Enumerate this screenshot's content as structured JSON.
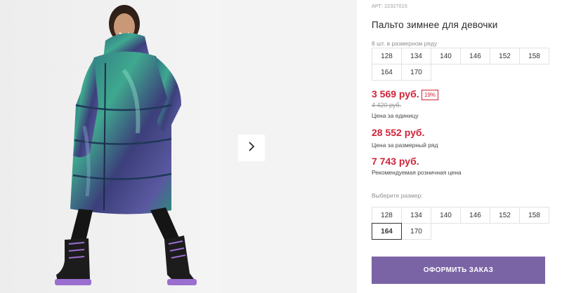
{
  "gallery": {
    "photo_alt": "Пальто зимнее для девочки",
    "next_icon": "chevron-right-icon"
  },
  "product": {
    "sku": "АРТ: 22327015",
    "title": "Пальто зимнее для девочки",
    "series_label": "8 шт. в размерном ряду",
    "series_sizes": [
      "128",
      "134",
      "140",
      "146",
      "152",
      "158",
      "164",
      "170"
    ],
    "price_unit": "3 569 руб.",
    "discount": "19%",
    "price_old": "4 420 руб.",
    "price_unit_note": "Цена за единицу",
    "price_series": "28 552 руб.",
    "price_series_note": "Цена за размерный ряд",
    "price_retail": "7 743 руб.",
    "price_retail_note": "Рекомендуемая розничная цена",
    "choose_label": "Выберите размер:",
    "sizes": [
      "128",
      "134",
      "140",
      "146",
      "152",
      "158",
      "164",
      "170"
    ],
    "selected_size": "164",
    "order_button": "ОФОРМИТЬ ЗАКАЗ"
  },
  "colors": {
    "price_red": "#d0243a",
    "button_purple": "#7b64a5"
  }
}
